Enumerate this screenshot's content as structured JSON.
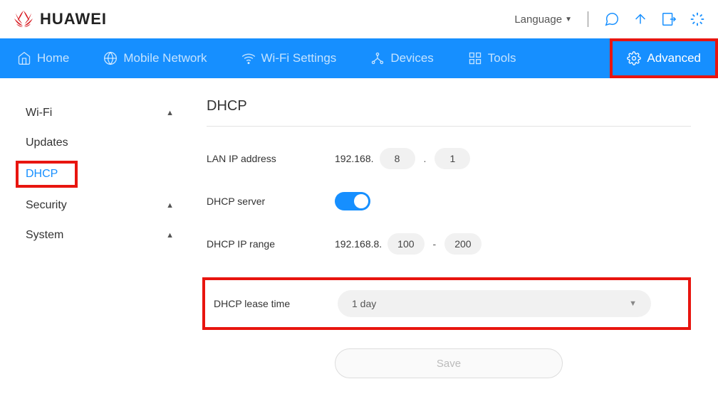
{
  "header": {
    "brand": "HUAWEI",
    "language_label": "Language"
  },
  "nav": {
    "home": "Home",
    "mobile_network": "Mobile Network",
    "wifi_settings": "Wi-Fi Settings",
    "devices": "Devices",
    "tools": "Tools",
    "advanced": "Advanced"
  },
  "sidebar": {
    "wifi": "Wi-Fi",
    "updates": "Updates",
    "dhcp": "DHCP",
    "security": "Security",
    "system": "System"
  },
  "page": {
    "title": "DHCP",
    "lan_ip_label": "LAN IP address",
    "lan_ip_prefix": "192.168.",
    "lan_ip_oct3": "8",
    "lan_ip_oct4": "1",
    "dhcp_server_label": "DHCP server",
    "dhcp_range_label": "DHCP IP range",
    "dhcp_range_prefix": "192.168.8.",
    "dhcp_range_start": "100",
    "dhcp_range_end": "200",
    "lease_label": "DHCP lease time",
    "lease_value": "1 day",
    "save": "Save",
    "dot": ".",
    "dash": "-"
  }
}
